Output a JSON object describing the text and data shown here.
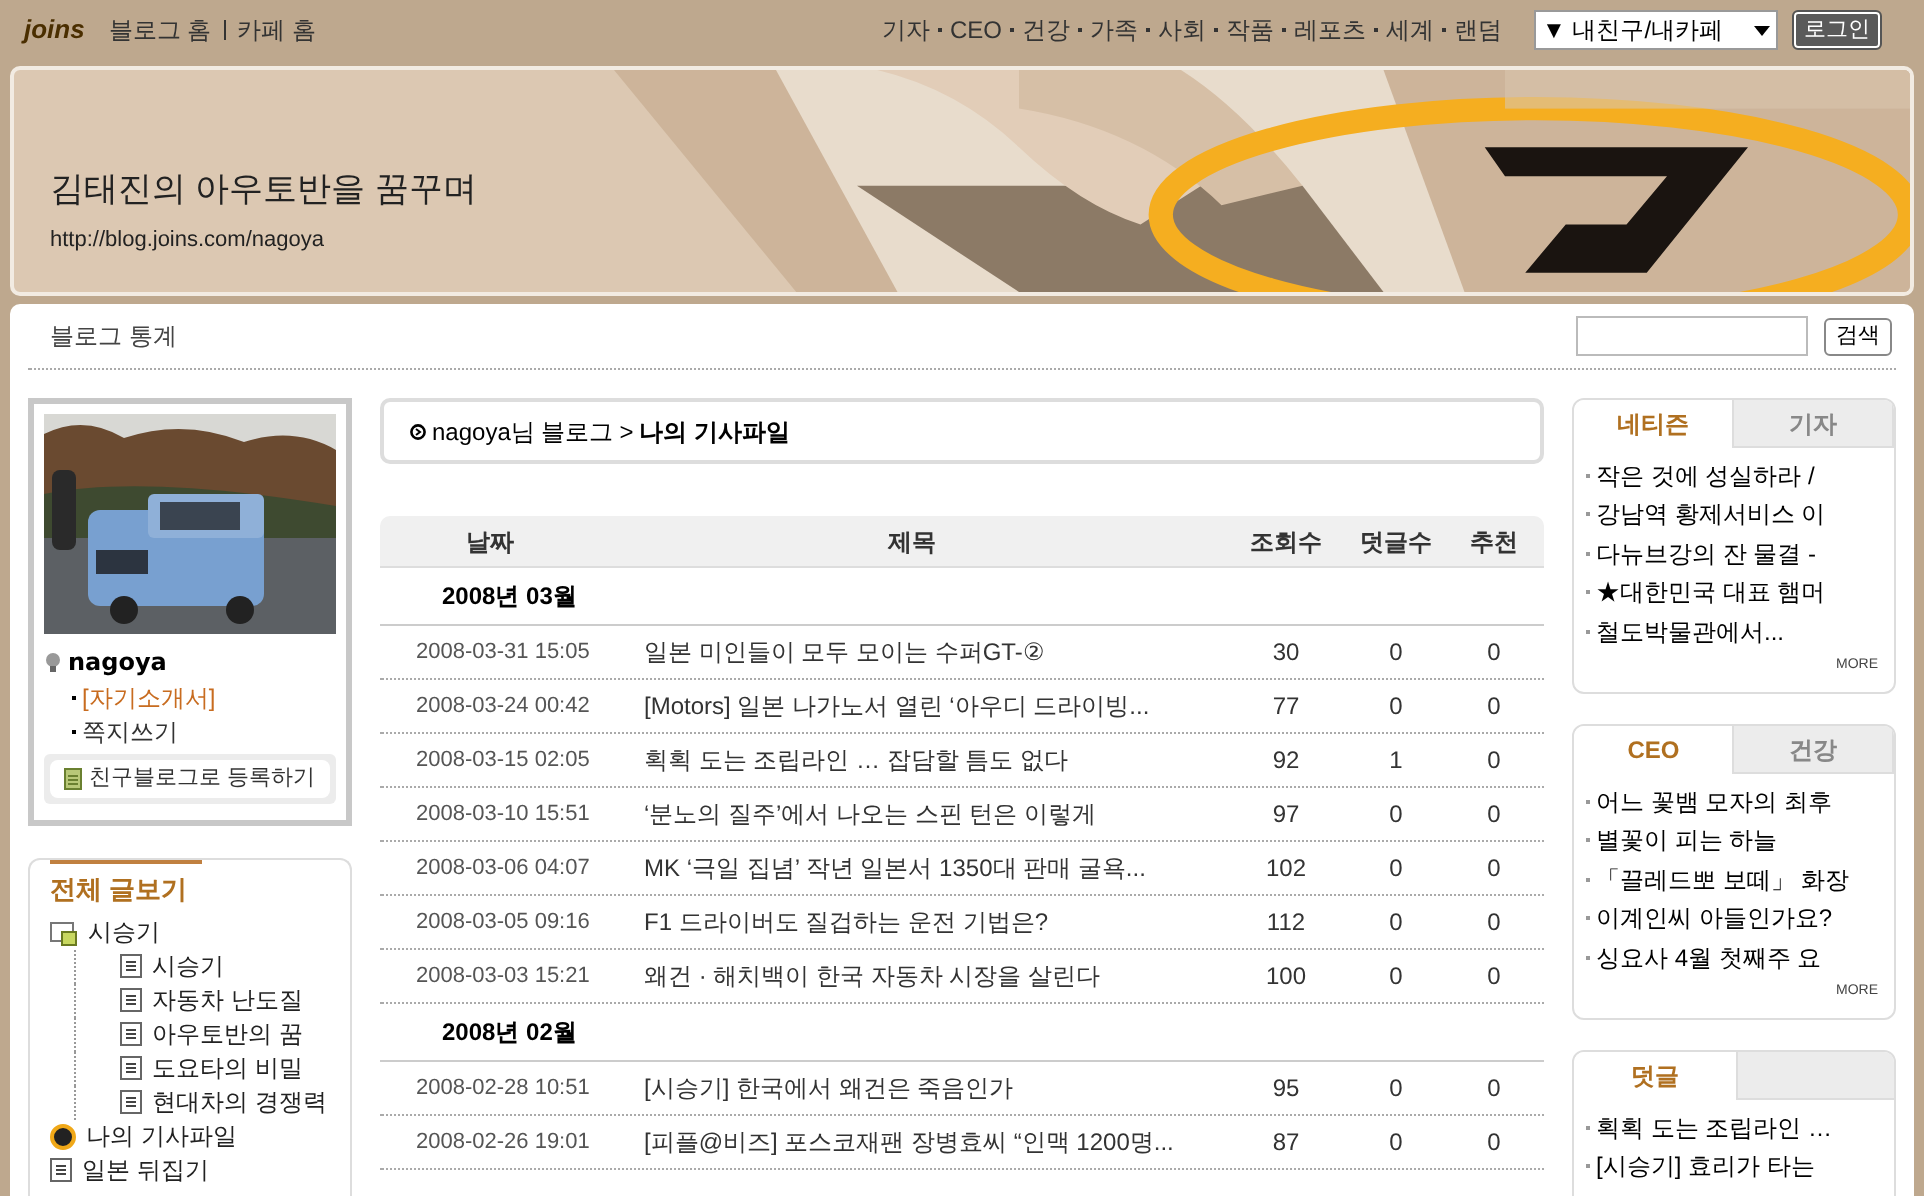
{
  "top_bar": {
    "logo": "joins",
    "links": [
      "블로그 홈",
      "카페 홈"
    ],
    "sections": [
      "기자",
      "CEO",
      "건강",
      "가족",
      "사회",
      "작품",
      "레포츠",
      "세계",
      "랜덤"
    ],
    "dropdown": "▼ 내친구/내카페",
    "login": "로그인"
  },
  "banner": {
    "title": "김태진의 아우토반을 꿈꾸며",
    "url": "http://blog.joins.com/nagoya"
  },
  "toolbar": {
    "stats": "블로그 통계",
    "search_button": "검색"
  },
  "profile": {
    "name": "nagoya",
    "links": [
      {
        "label": "[자기소개서]",
        "highlight": true
      },
      {
        "label": "쪽지쓰기",
        "highlight": false
      }
    ],
    "add_button": "친구블로그로 등록하기"
  },
  "categories": {
    "title": "전체 글보기",
    "tree": [
      {
        "label": "시승기",
        "kind": "folder",
        "children": [
          {
            "label": "시승기",
            "kind": "page"
          },
          {
            "label": "자동차 난도질",
            "kind": "page"
          },
          {
            "label": "아우토반의 꿈",
            "kind": "page"
          },
          {
            "label": "도요타의 비밀",
            "kind": "page"
          },
          {
            "label": "현대차의 경쟁력",
            "kind": "page"
          }
        ]
      },
      {
        "label": "나의 기사파일",
        "kind": "article"
      },
      {
        "label": "일본 뒤집기",
        "kind": "page"
      }
    ]
  },
  "breadcrumb": {
    "blog": "nagoya님 블로그",
    "separator": ">",
    "current": "나의 기사파일"
  },
  "table": {
    "columns": [
      "날짜",
      "제목",
      "조회수",
      "덧글수",
      "추천"
    ],
    "groups": [
      {
        "month": "2008년 03월",
        "rows": [
          [
            "2008-03-31 15:05",
            "일본 미인들이 모두 모이는 수퍼GT-②",
            "30",
            "0",
            "0"
          ],
          [
            "2008-03-24 00:42",
            "[Motors] 일본 나가노서 열린 ‘아우디 드라이빙...",
            "77",
            "0",
            "0"
          ],
          [
            "2008-03-15 02:05",
            "획획 도는 조립라인 … 잡담할 틈도 없다",
            "92",
            "1",
            "0"
          ],
          [
            "2008-03-10 15:51",
            "‘분노의 질주’에서 나오는 스핀 턴은 이렇게",
            "97",
            "0",
            "0"
          ],
          [
            "2008-03-06 04:07",
            "MK ‘극일 집념’ 작년 일본서 1350대 판매 굴욕...",
            "102",
            "0",
            "0"
          ],
          [
            "2008-03-05 09:16",
            "F1 드라이버도 질겁하는 운전 기법은?",
            "112",
            "0",
            "0"
          ],
          [
            "2008-03-03 15:21",
            "왜건 · 해치백이 한국 자동차 시장을 살린다",
            "100",
            "0",
            "0"
          ]
        ]
      },
      {
        "month": "2008년 02월",
        "rows": [
          [
            "2008-02-28 10:51",
            "[시승기] 한국에서 왜건은 죽음인가",
            "95",
            "0",
            "0"
          ],
          [
            "2008-02-26 19:01",
            "[피플@비즈] 포스코재팬 장병효씨 “인맥 1200명...",
            "87",
            "0",
            "0"
          ]
        ]
      }
    ]
  },
  "widgets": [
    {
      "tabs": [
        {
          "label": "네티즌",
          "selected": true
        },
        {
          "label": "기자",
          "selected": false
        }
      ],
      "items": [
        "작은 것에 성실하라 /",
        "강남역 황제서비스 이",
        "다뉴브강의 잔 물결 -",
        "★대한민국 대표 햄머",
        "철도박물관에서..."
      ],
      "more": "MORE"
    },
    {
      "tabs": [
        {
          "label": "CEO",
          "selected": true
        },
        {
          "label": "건강",
          "selected": false
        }
      ],
      "items": [
        "어느 꽃뱀 모자의 최후",
        "별꽃이 피는 하늘",
        "「끌레드뽀 보떼」 화장",
        "이계인씨 아들인가요?",
        "싱요사 4월 첫째주 요"
      ],
      "more": "MORE"
    },
    {
      "tabs": [
        {
          "label": "덧글",
          "selected": true
        }
      ],
      "items": [
        "획획 도는 조립라인 …",
        "[시승기] 효리가 타는"
      ]
    }
  ]
}
